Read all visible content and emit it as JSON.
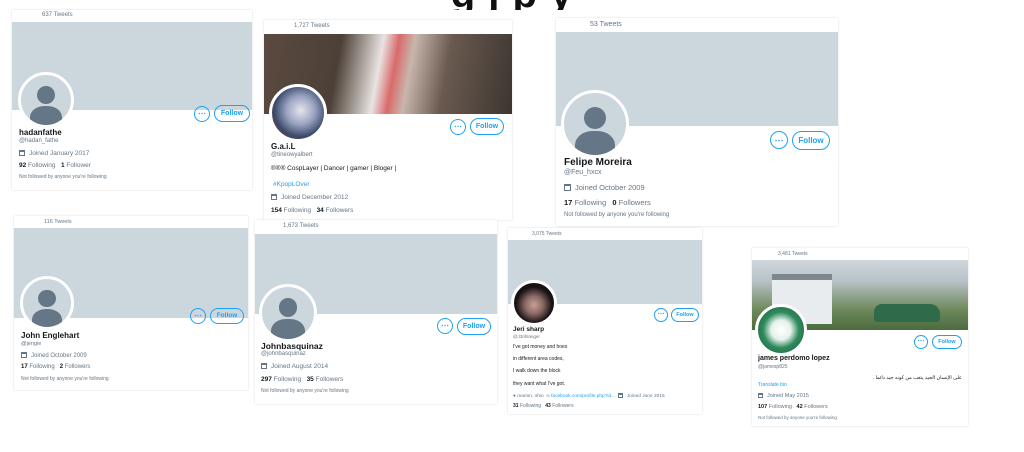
{
  "page": {
    "header_fragment": "g  j   p    y"
  },
  "cards": [
    {
      "tweets": "637 Tweets",
      "name": "hadanfathe",
      "handle": "@hadan_fathe",
      "joined": "Joined January 2017",
      "following": "92",
      "following_label": "Following",
      "followers": "1",
      "followers_label": "Follower",
      "not_followed": "Not followed by anyone you're following",
      "follow_label": "Follow",
      "more_label": "⋯",
      "avatar": "default-avatar"
    },
    {
      "tweets": "1,727 Tweets",
      "name": "G.a.i.L",
      "handle": "@tineowyalbert",
      "bio": "®®® CospLayer | Dancer | gamer | Bloger |",
      "hashtag": "#KpopLOver",
      "joined": "Joined December 2012",
      "following": "154",
      "following_label": "Following",
      "followers": "34",
      "followers_label": "Followers",
      "follow_label": "Follow",
      "more_label": "⋯",
      "avatar": "photo-avatar"
    },
    {
      "tweets": "53 Tweets",
      "name": "Felipe  Moreira",
      "handle": "@Feu_hxcx",
      "joined": "Joined October 2009",
      "following": "17",
      "following_label": "Following",
      "followers": "0",
      "followers_label": "Followers",
      "not_followed": "Not followed by anyone you're following",
      "follow_label": "Follow",
      "more_label": "⋯",
      "avatar": "default-avatar"
    },
    {
      "tweets": "116 Tweets",
      "name": "John Englehart",
      "handle": "@jengie",
      "joined": "Joined October 2009",
      "following": "17",
      "following_label": "Following",
      "followers": "2",
      "followers_label": "Followers",
      "not_followed": "Not followed by anyone you're following",
      "follow_label": "Follow",
      "more_label": "⋯",
      "avatar": "default-avatar"
    },
    {
      "tweets": "1,673 Tweets",
      "name": "Johnbasquinaz",
      "handle": "@johnbasquinaz",
      "joined": "Joined August 2014",
      "following": "297",
      "following_label": "Following",
      "followers": "35",
      "followers_label": "Followers",
      "not_followed": "Not followed by anyone you're following",
      "follow_label": "Follow",
      "more_label": "⋯",
      "avatar": "default-avatar"
    },
    {
      "tweets": "3,075 Tweets",
      "name": "Jeri sharp",
      "handle": "@J3rihlanger",
      "bio_lines": [
        "I've got money and hoes",
        "in different area codes,",
        "I walk down the block",
        "they want what I've got."
      ],
      "location": "marion, ohio",
      "website": "facebook.com/profile.php?id...",
      "joined": "Joined June 2016",
      "following": "31",
      "following_label": "Following",
      "followers": "43",
      "followers_label": "Followers",
      "follow_label": "Follow",
      "more_label": "⋯",
      "avatar": "photo-avatar"
    },
    {
      "tweets": "3,481 Tweets",
      "name": "james perdomo lopez",
      "handle": "@jamesp825",
      "bio_rtl": "على الإنسان الجيد يتعب من كونه جيد دائما .",
      "translate": "Translate bio",
      "joined": "Joined May 2015",
      "following": "107",
      "following_label": "Following",
      "followers": "42",
      "followers_label": "Followers",
      "not_followed": "Not followed by anyone you're following",
      "follow_label": "Follow",
      "more_label": "⋯",
      "avatar": "photo-avatar"
    }
  ],
  "colors": {
    "accent": "#1da1f2",
    "banner": "#ccd6dd",
    "muted": "#657786"
  }
}
